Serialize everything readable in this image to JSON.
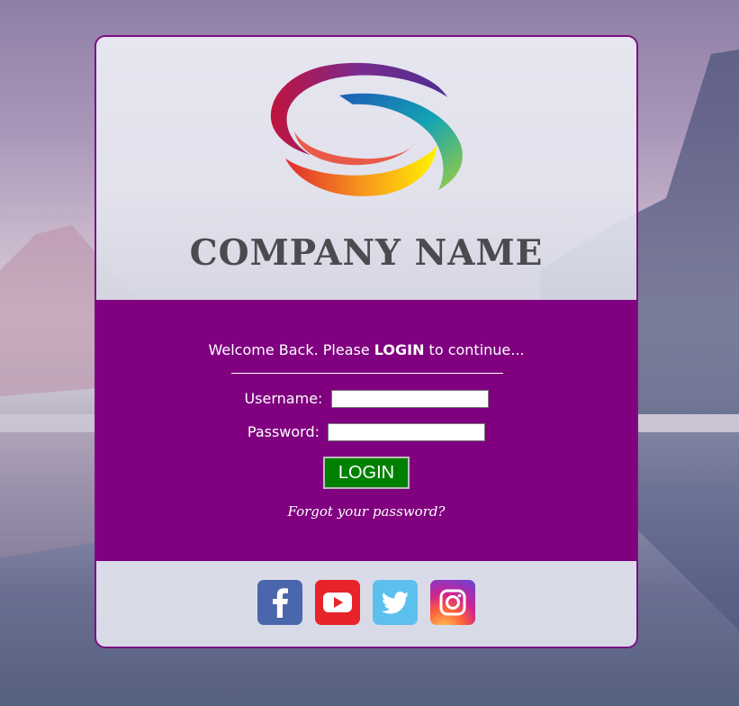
{
  "brand": {
    "company_name": "COMPANY NAME",
    "logo_icon": "swirl-logo-icon",
    "accent_color": "#800080",
    "button_color": "#008000"
  },
  "login": {
    "welcome_prefix": "Welcome Back. Please ",
    "welcome_bold": "LOGIN",
    "welcome_suffix": " to continue...",
    "username_label": "Username:",
    "username_value": "",
    "password_label": "Password:",
    "password_value": "",
    "login_button": "LOGIN",
    "forgot_link": "Forgot your password?"
  },
  "social": [
    {
      "name": "facebook",
      "icon": "facebook-icon"
    },
    {
      "name": "youtube",
      "icon": "youtube-icon"
    },
    {
      "name": "twitter",
      "icon": "twitter-icon"
    },
    {
      "name": "instagram",
      "icon": "instagram-icon"
    }
  ]
}
